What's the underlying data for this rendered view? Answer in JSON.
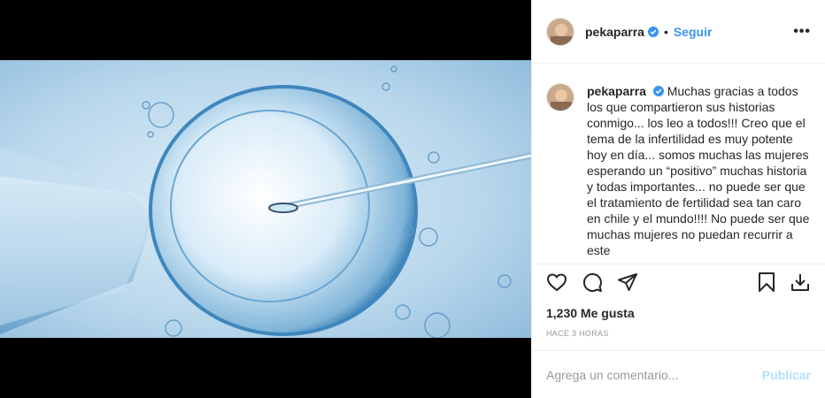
{
  "post": {
    "username": "pekaparra",
    "follow_label": "Seguir",
    "dot": "•",
    "more": "•••",
    "caption": "Muchas gracias a todos los que compartieron sus historias conmigo... los leo a todos!!! Creo que el tema de la infertilidad es muy potente hoy en día... somos muchas las mujeres esperando un “positivo” muchas historia y todas importantes... no puede ser que el tratamiento de fertilidad sea tan caro en chile y el mundo!!!! No puede ser que muchas mujeres no puedan recurrir a este",
    "likes": "1,230 Me gusta",
    "time": "HACE 3 HORAS"
  },
  "comment": {
    "placeholder": "Agrega un comentario...",
    "publish_label": "Publicar"
  },
  "icons": {
    "like": "heart-icon",
    "comment": "comment-icon",
    "share": "send-icon",
    "save": "bookmark-icon",
    "download": "download-icon",
    "verified": "verified-badge-icon"
  },
  "colors": {
    "link": "#3897f0",
    "publish_disabled": "#b2dffc",
    "verified": "#3897f0"
  }
}
